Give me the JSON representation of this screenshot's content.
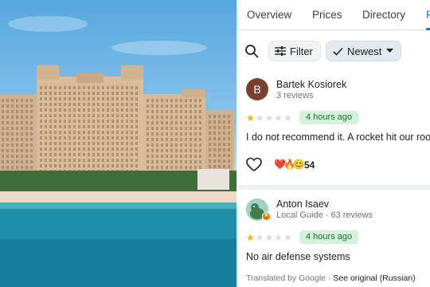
{
  "tabs": [
    "Overview",
    "Prices",
    "Directory",
    "R"
  ],
  "toolbar": {
    "filter_label": "Filter",
    "sort_label": "Newest"
  },
  "reviews": [
    {
      "avatar_letter": "B",
      "name": "Bartek Kosiorek",
      "meta": "3 reviews",
      "rating": 1,
      "time": "4 hours ago",
      "text": "I do not recommend it. A rocket hit our roo",
      "reactions": "❤️🔥😊",
      "reaction_count": "54"
    },
    {
      "name": "Anton Isaev",
      "meta": "Local Guide · 63 reviews",
      "rating": 1,
      "time": "4 hours ago",
      "text": "No air defense systems"
    }
  ],
  "footer": {
    "translated_prefix": "Translated by Google · ",
    "see_original": "See original (Russian)"
  },
  "colors": {
    "accent": "#1a73e8",
    "star": "#f6b400",
    "badge_bg": "#d6f1dc",
    "badge_text": "#137333"
  }
}
